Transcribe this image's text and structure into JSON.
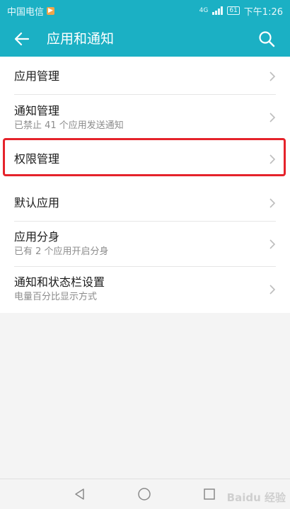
{
  "status_bar": {
    "carrier": "中国电信",
    "network": "4G",
    "battery": "61",
    "time": "下午1:26"
  },
  "app_bar": {
    "title": "应用和通知"
  },
  "menu": {
    "items": [
      {
        "label": "应用管理",
        "sub": ""
      },
      {
        "label": "通知管理",
        "sub": "已禁止 41 个应用发送通知"
      },
      {
        "label": "权限管理",
        "sub": ""
      },
      {
        "label": "默认应用",
        "sub": ""
      },
      {
        "label": "应用分身",
        "sub": "已有 2 个应用开启分身"
      },
      {
        "label": "通知和状态栏设置",
        "sub": "电量百分比显示方式"
      }
    ]
  },
  "watermark": "Baidu 经验",
  "colors": {
    "accent": "#1bb0c4",
    "highlight": "#e5232b"
  }
}
